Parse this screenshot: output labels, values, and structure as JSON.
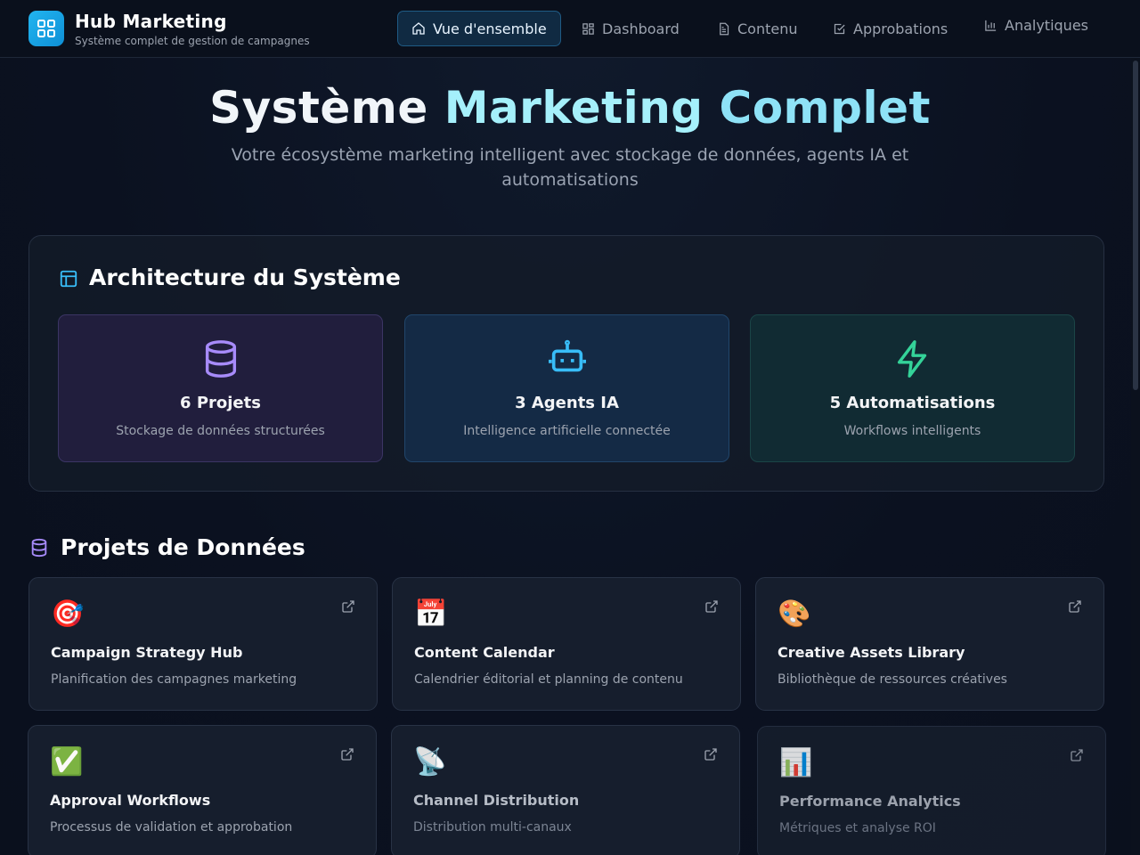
{
  "header": {
    "brand_title": "Hub Marketing",
    "brand_subtitle": "Système complet de gestion de campagnes",
    "nav": [
      {
        "label": "Vue d'ensemble",
        "icon": "home-icon",
        "active": true
      },
      {
        "label": "Dashboard",
        "icon": "grid-icon",
        "active": false
      },
      {
        "label": "Contenu",
        "icon": "document-icon",
        "active": false
      },
      {
        "label": "Approbations",
        "icon": "check-square-icon",
        "active": false
      },
      {
        "label": "Analytiques",
        "icon": "bar-chart-icon",
        "active": false
      }
    ]
  },
  "hero": {
    "title_part1": "Système",
    "title_part2": "Marketing",
    "title_part3": "Complet",
    "subtitle": "Votre écosystème marketing intelligent avec stockage de données, agents IA et automatisations"
  },
  "architecture": {
    "title": "Architecture du Système",
    "cards": [
      {
        "label": "6 Projets",
        "description": "Stockage de données structurées",
        "icon": "database-icon",
        "color": "#a78bfa"
      },
      {
        "label": "3 Agents IA",
        "description": "Intelligence artificielle connectée",
        "icon": "robot-icon",
        "color": "#38bdf8"
      },
      {
        "label": "5 Automatisations",
        "description": "Workflows intelligents",
        "icon": "lightning-icon",
        "color": "#34d399"
      }
    ]
  },
  "projects": {
    "title": "Projets de Données",
    "items": [
      {
        "emoji": "🎯",
        "name": "Campaign Strategy Hub",
        "description": "Planification des campagnes marketing"
      },
      {
        "emoji": "📅",
        "name": "Content Calendar",
        "description": "Calendrier éditorial et planning de contenu"
      },
      {
        "emoji": "🎨",
        "name": "Creative Assets Library",
        "description": "Bibliothèque de ressources créatives"
      },
      {
        "emoji": "✅",
        "name": "Approval Workflows",
        "description": "Processus de validation et approbation"
      },
      {
        "emoji": "📡",
        "name": "Channel Distribution",
        "description": "Distribution multi-canaux"
      },
      {
        "emoji": "📊",
        "name": "Performance Analytics",
        "description": "Métriques et analyse ROI"
      }
    ]
  },
  "colors": {
    "accent": "#22b5f0",
    "background": "#0d1422"
  }
}
